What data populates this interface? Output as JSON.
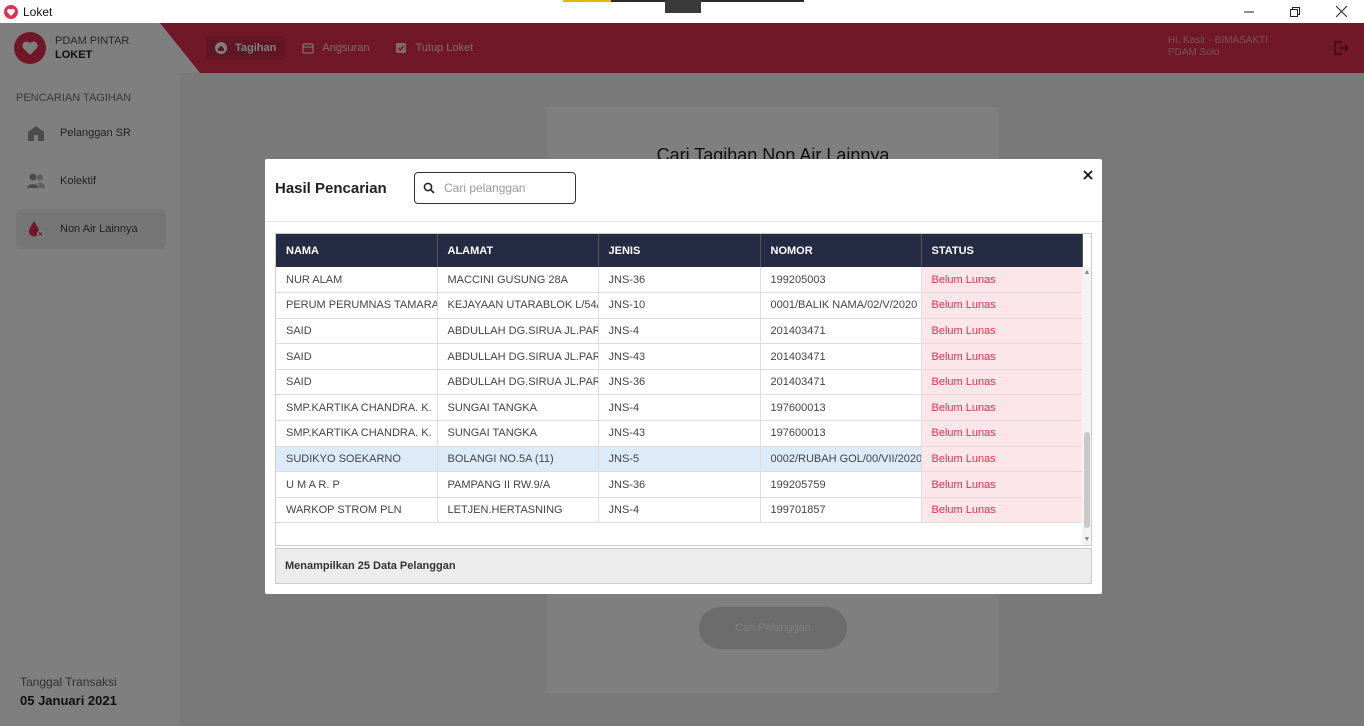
{
  "window": {
    "title": "Loket",
    "icon": "app-heart-icon"
  },
  "brand": {
    "line1": "PDAM PINTAR",
    "line2": "LOKET",
    "accent": "#e0304f"
  },
  "nav": {
    "items": [
      {
        "label": "Tagihan",
        "icon": "home-icon",
        "active": true
      },
      {
        "label": "Angsuran",
        "icon": "calendar-icon",
        "active": false
      },
      {
        "label": "Tutup Loket",
        "icon": "checkbox-icon",
        "active": false
      }
    ]
  },
  "user": {
    "greeting": "Hi, Kasir - BIMASAKTI",
    "branch": "PDAM Solo"
  },
  "sidebar": {
    "title": "PENCARIAN TAGIHAN",
    "items": [
      {
        "label": "Pelanggan SR",
        "icon": "house-icon"
      },
      {
        "label": "Kolektif",
        "icon": "people-icon"
      },
      {
        "label": "Non Air Lainnya",
        "icon": "water-drop-icon",
        "active": true
      }
    ],
    "date_label": "Tanggal Transaksi",
    "date_value": "05 Januari 2021"
  },
  "background": {
    "title": "Cari Tagihan Non Air Lainnya",
    "button": "Cari Pelanggan"
  },
  "modal": {
    "title": "Hasil Pencarian",
    "search_placeholder": "Cari pelanggan",
    "columns": [
      "NAMA",
      "ALAMAT",
      "JENIS",
      "NOMOR",
      "STATUS"
    ],
    "rows": [
      [
        "NUR ALAM",
        "MACCINI GUSUNG 28A",
        "JNS-36",
        "199205003",
        "Belum Lunas"
      ],
      [
        "PERUM PERUMNAS TAMARA",
        "KEJAYAAN UTARABLOK L/54/",
        "JNS-10",
        "0001/BALIK NAMA/02/V/2020",
        "Belum Lunas"
      ],
      [
        "SAID",
        "ABDULLAH DG.SIRUA JL.PARC",
        "JNS-4",
        "201403471",
        "Belum Lunas"
      ],
      [
        "SAID",
        "ABDULLAH DG.SIRUA JL.PARC",
        "JNS-43",
        "201403471",
        "Belum Lunas"
      ],
      [
        "SAID",
        "ABDULLAH DG.SIRUA JL.PARC",
        "JNS-36",
        "201403471",
        "Belum Lunas"
      ],
      [
        "SMP.KARTIKA CHANDRA. K.",
        "SUNGAI TANGKA",
        "JNS-4",
        "197600013",
        "Belum Lunas"
      ],
      [
        "SMP.KARTIKA CHANDRA. K.",
        "SUNGAI TANGKA",
        "JNS-43",
        "197600013",
        "Belum Lunas"
      ],
      [
        "SUDIKYO SOEKARNO",
        "BOLANGI NO.5A (11)",
        "JNS-5",
        "0002/RUBAH GOL/00/VII/2020",
        "Belum Lunas"
      ],
      [
        "U M A R. P",
        "PAMPANG II RW.9/A",
        "JNS-36",
        "199205759",
        "Belum Lunas"
      ],
      [
        "WARKOP STROM PLN",
        "LETJEN.HERTASNING",
        "JNS-4",
        "199701857",
        "Belum Lunas"
      ]
    ],
    "selected_row": 7,
    "footer": "Menampilkan 25 Data Pelanggan"
  }
}
